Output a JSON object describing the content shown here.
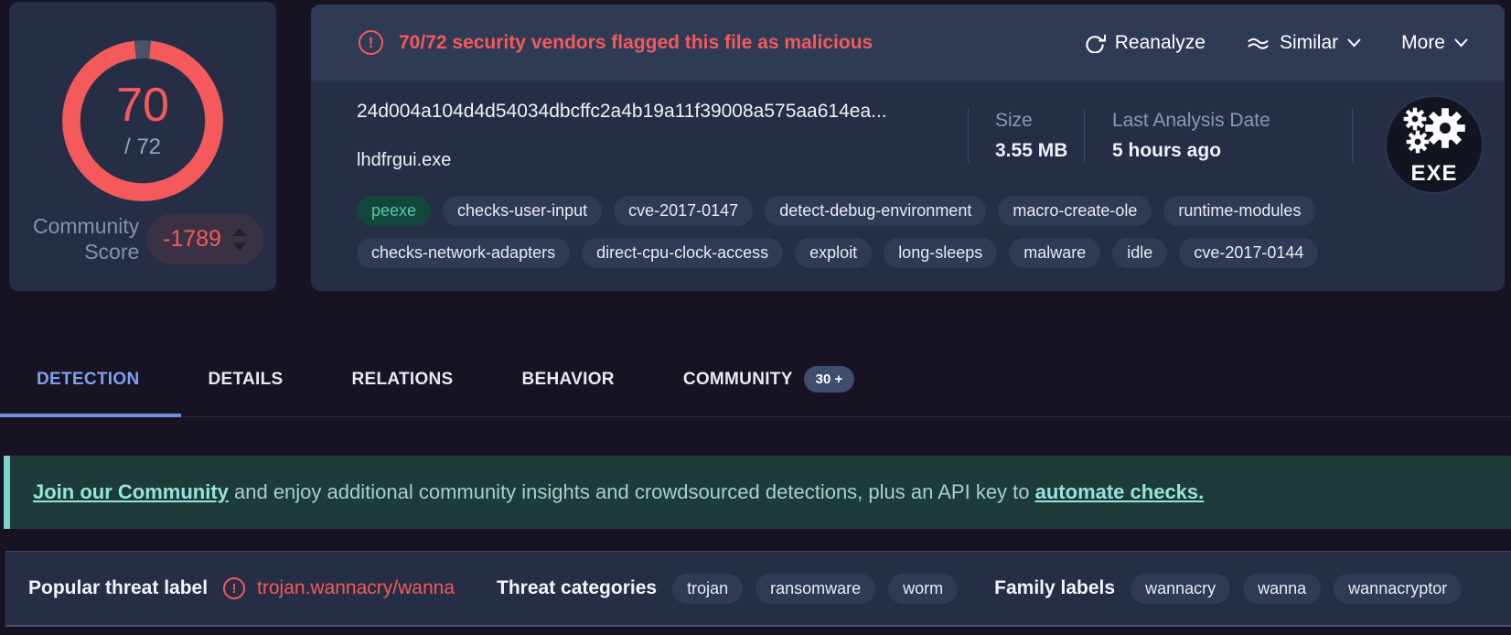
{
  "score_card": {
    "score": "70",
    "score_total": "/ 72",
    "community_label_top": "Community",
    "community_label_bottom": "Score",
    "community_score": "-1789"
  },
  "file_card": {
    "alert_text": "70/72 security vendors flagged this file as malicious",
    "reanalyze_label": "Reanalyze",
    "similar_label": "Similar",
    "more_label": "More",
    "sha256_short": "24d004a104d4d54034dbcffc2a4b19a11f39008a575aa614ea...",
    "filename": "lhdfrgui.exe",
    "size_label": "Size",
    "size_value": "3.55 MB",
    "last_analysis_label": "Last Analysis Date",
    "last_analysis_value": "5 hours ago",
    "file_type_badge": "EXE",
    "tags_row1": [
      {
        "label": "peexe",
        "variant": "green"
      },
      "checks-user-input",
      "cve-2017-0147",
      "detect-debug-environment",
      "macro-create-ole",
      "runtime-modules"
    ],
    "tags_row2": [
      "checks-network-adapters",
      "direct-cpu-clock-access",
      "exploit",
      "long-sleeps",
      "malware",
      "idle",
      "cve-2017-0144"
    ]
  },
  "tabs": {
    "detection": "DETECTION",
    "details": "DETAILS",
    "relations": "RELATIONS",
    "behavior": "BEHAVIOR",
    "community": "COMMUNITY",
    "community_badge": "30 +"
  },
  "banner": {
    "link_join": "Join our Community",
    "text_middle": " and enjoy additional community insights and crowdsourced detections, plus an API key to ",
    "link_automate": "automate checks."
  },
  "threat": {
    "popular_label": "Popular threat label",
    "popular_value": "trojan.wannacry/wanna",
    "categories_label": "Threat categories",
    "categories": [
      "trojan",
      "ransomware",
      "worm"
    ],
    "families_label": "Family labels",
    "families": [
      "wannacry",
      "wanna",
      "wannacryptor"
    ]
  },
  "colors": {
    "accent_red": "#f4595b",
    "active_tab_blue": "#7da0ef",
    "tag_green_bg": "#13463a",
    "tag_green_text": "#53c6ad",
    "banner_bg": "#1c3b39",
    "banner_teal_text": "#98e3dc",
    "card_bg": "#252e44",
    "strip_bg": "#2f3b55",
    "pill_bg": "#2f3a55",
    "page_bg": "#171322"
  }
}
